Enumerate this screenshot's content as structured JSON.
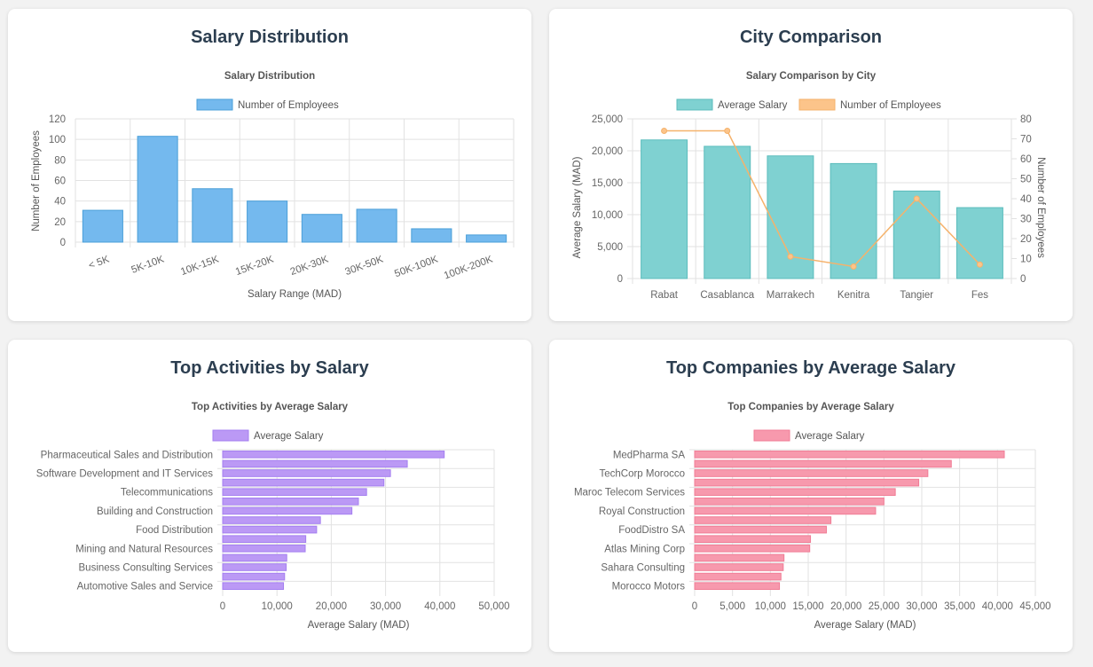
{
  "cards": {
    "salary": {
      "heading": "Salary Distribution"
    },
    "city": {
      "heading": "City Comparison"
    },
    "activities": {
      "heading": "Top Activities by Salary"
    },
    "companies": {
      "heading": "Top Companies by Average Salary"
    }
  },
  "colors": {
    "blue_fill": "#74b9ee",
    "blue_stroke": "#4a9fd8",
    "teal_fill": "#7fd1d1",
    "teal_stroke": "#5bbcbc",
    "orange": "#f5b26b",
    "orange_fill": "#fcc48a",
    "purple_fill": "#bb99f5",
    "purple_stroke": "#a47ff0",
    "pink_fill": "#f799ad",
    "pink_stroke": "#f07d96"
  },
  "chart_data": [
    {
      "id": "salary",
      "type": "bar",
      "title": "Salary Distribution",
      "categories": [
        "< 5K",
        "5K-10K",
        "10K-15K",
        "15K-20K",
        "20K-30K",
        "30K-50K",
        "50K-100K",
        "100K-200K"
      ],
      "series": [
        {
          "name": "Number of Employees",
          "values": [
            31,
            103,
            52,
            40,
            27,
            32,
            13,
            7
          ]
        }
      ],
      "xlabel": "Salary Range (MAD)",
      "ylabel": "Number of Employees",
      "ylim": [
        0,
        120
      ],
      "yticks": [
        0,
        20,
        40,
        60,
        80,
        100,
        120
      ],
      "legend": "top",
      "grid": true
    },
    {
      "id": "city",
      "type": "bar",
      "title": "Salary Comparison by City",
      "categories": [
        "Rabat",
        "Casablanca",
        "Marrakech",
        "Kenitra",
        "Tangier",
        "Fes"
      ],
      "series": [
        {
          "name": "Average Salary",
          "type": "bar",
          "axis": "left",
          "values": [
            21700,
            20700,
            19200,
            18000,
            13700,
            11100
          ]
        },
        {
          "name": "Number of Employees",
          "type": "line",
          "axis": "right",
          "values": [
            74,
            74,
            11,
            6,
            40,
            7
          ]
        }
      ],
      "ylabel": "Average Salary (MAD)",
      "y2label": "Number of Employees",
      "ylim": [
        0,
        25000
      ],
      "yticks": [
        "0",
        "5,000",
        "10,000",
        "15,000",
        "20,000",
        "25,000"
      ],
      "y2lim": [
        0,
        80
      ],
      "y2ticks": [
        "0",
        "10",
        "20",
        "30",
        "40",
        "50",
        "60",
        "70",
        "80"
      ],
      "legend": "top",
      "grid": true
    },
    {
      "id": "activities",
      "type": "bar",
      "orientation": "horizontal",
      "title": "Top Activities by Average Salary",
      "categories": [
        "Pharmaceutical Sales and Distribution",
        "",
        "Software Development and IT Services",
        "",
        "Telecommunications",
        "",
        "Building and Construction",
        "",
        "Food Distribution",
        "",
        "Mining and Natural Resources",
        "",
        "Business Consulting Services",
        "",
        "Automotive Sales and Service"
      ],
      "series": [
        {
          "name": "Average Salary",
          "values": [
            40800,
            34000,
            30900,
            29700,
            26500,
            25000,
            23800,
            18000,
            17300,
            15300,
            15200,
            11800,
            11700,
            11400,
            11200
          ]
        }
      ],
      "xlabel": "Average Salary (MAD)",
      "xlim": [
        0,
        50000
      ],
      "xticks": [
        "0",
        "10,000",
        "20,000",
        "30,000",
        "40,000",
        "50,000"
      ],
      "legend": "top",
      "grid": true
    },
    {
      "id": "companies",
      "type": "bar",
      "orientation": "horizontal",
      "title": "Top Companies by Average Salary",
      "categories": [
        "MedPharma SA",
        "",
        "TechCorp Morocco",
        "",
        "Maroc Telecom Services",
        "",
        "Royal Construction",
        "",
        "FoodDistro SA",
        "",
        "Atlas Mining Corp",
        "",
        "Sahara Consulting",
        "",
        "Morocco Motors"
      ],
      "series": [
        {
          "name": "Average Salary",
          "values": [
            40900,
            33900,
            30800,
            29600,
            26500,
            25000,
            23900,
            18000,
            17400,
            15300,
            15200,
            11800,
            11700,
            11400,
            11200
          ]
        }
      ],
      "xlabel": "Average Salary (MAD)",
      "xlim": [
        0,
        45000
      ],
      "xticks": [
        "0",
        "5,000",
        "10,000",
        "15,000",
        "20,000",
        "25,000",
        "30,000",
        "35,000",
        "40,000",
        "45,000"
      ],
      "legend": "top",
      "grid": true
    }
  ]
}
